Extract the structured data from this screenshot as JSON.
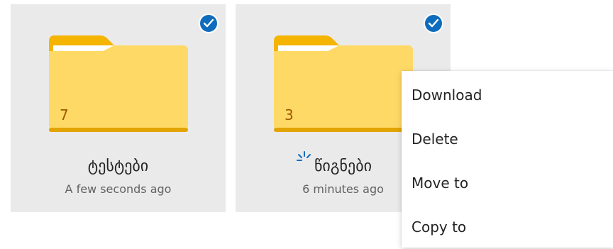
{
  "folders": [
    {
      "count": "7",
      "name": "ტესტები",
      "modified": "A few seconds ago",
      "selected": true
    },
    {
      "count": "3",
      "name": "წიგნები",
      "modified": "6 minutes ago",
      "selected": true
    }
  ],
  "context_menu": {
    "items": [
      "Download",
      "Delete",
      "Move to",
      "Copy to"
    ]
  },
  "icons": {
    "selected": "checkmark-circle-icon",
    "folder": "folder-icon",
    "cursor": "loading-spark-icon"
  },
  "colors": {
    "accent": "#0f6cbd",
    "tile": "#ebeaea",
    "folder": "#ffd966",
    "folder_tab": "#f4b400"
  }
}
